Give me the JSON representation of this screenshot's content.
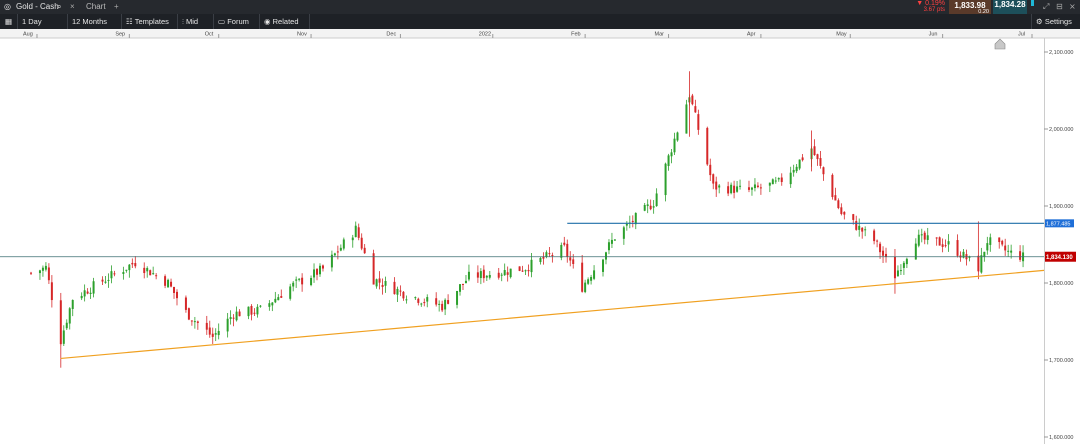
{
  "window": {
    "title": "Gold - Cash",
    "tab2": "Chart",
    "add_tab": "+",
    "search_icon": "search-icon",
    "close_glyph": "×"
  },
  "price_panel": {
    "change_pct": "▼ 0.19%",
    "change_pts": "3.67 pts",
    "sell": "1,833.98",
    "spread": "0.20",
    "buy": "1,834.28"
  },
  "toolbar": {
    "interval": "1 Day",
    "range": "12 Months",
    "templates": "Templates",
    "mid": "Mid",
    "forum": "Forum",
    "related": "Related",
    "settings": "Settings"
  },
  "colors": {
    "bull": "#2ca02c",
    "bear": "#d62728",
    "trend": "#f0a020",
    "resistance": "#1f6fa8",
    "current_price_bg": "#c00000"
  },
  "chart_data": {
    "type": "candlestick",
    "instrument": "Gold - Cash",
    "interval": "1 Day",
    "x_ticks": [
      "Aug",
      "Sep",
      "Oct",
      "Nov",
      "Dec",
      "2022",
      "Feb",
      "Mar",
      "Apr",
      "May",
      "Jun",
      "Jul"
    ],
    "y_ticks": [
      "2,100.000",
      "2,000.000",
      "1,900.000",
      "1,800.000",
      "1,700.000",
      "1,600.000"
    ],
    "ylim": [
      1600,
      2120
    ],
    "current_price": "1,834.130",
    "horizontal_line_label": "1,877.485",
    "horizontal_line_value": 1877.5,
    "trendline": {
      "from": {
        "date": "2021-08-09",
        "value": 1702
      },
      "to": {
        "date": "2022-07-01",
        "value": 1815
      }
    },
    "anchors": [
      {
        "date": "2021-07-30",
        "value": 1813
      },
      {
        "date": "2021-08-04",
        "value": 1820
      },
      {
        "date": "2021-08-09",
        "value": 1726
      },
      {
        "date": "2021-08-13",
        "value": 1780
      },
      {
        "date": "2021-08-24",
        "value": 1805
      },
      {
        "date": "2021-09-03",
        "value": 1827
      },
      {
        "date": "2021-09-14",
        "value": 1800
      },
      {
        "date": "2021-09-20",
        "value": 1762
      },
      {
        "date": "2021-09-29",
        "value": 1730
      },
      {
        "date": "2021-10-06",
        "value": 1760
      },
      {
        "date": "2021-10-15",
        "value": 1765
      },
      {
        "date": "2021-10-25",
        "value": 1795
      },
      {
        "date": "2021-11-05",
        "value": 1818
      },
      {
        "date": "2021-11-16",
        "value": 1870
      },
      {
        "date": "2021-11-22",
        "value": 1805
      },
      {
        "date": "2021-12-03",
        "value": 1785
      },
      {
        "date": "2021-12-15",
        "value": 1770
      },
      {
        "date": "2021-12-24",
        "value": 1808
      },
      {
        "date": "2022-01-05",
        "value": 1815
      },
      {
        "date": "2022-01-12",
        "value": 1820
      },
      {
        "date": "2022-01-25",
        "value": 1845
      },
      {
        "date": "2022-01-31",
        "value": 1795
      },
      {
        "date": "2022-02-11",
        "value": 1860
      },
      {
        "date": "2022-02-24",
        "value": 1905
      },
      {
        "date": "2022-03-08",
        "value": 2045
      },
      {
        "date": "2022-03-16",
        "value": 1925
      },
      {
        "date": "2022-03-28",
        "value": 1920
      },
      {
        "date": "2022-04-07",
        "value": 1930
      },
      {
        "date": "2022-04-18",
        "value": 1975
      },
      {
        "date": "2022-04-28",
        "value": 1890
      },
      {
        "date": "2022-05-09",
        "value": 1855
      },
      {
        "date": "2022-05-16",
        "value": 1810
      },
      {
        "date": "2022-05-23",
        "value": 1858
      },
      {
        "date": "2022-06-03",
        "value": 1850
      },
      {
        "date": "2022-06-13",
        "value": 1820
      },
      {
        "date": "2022-06-16",
        "value": 1855
      },
      {
        "date": "2022-06-23",
        "value": 1840
      },
      {
        "date": "2022-06-28",
        "value": 1834
      }
    ]
  }
}
